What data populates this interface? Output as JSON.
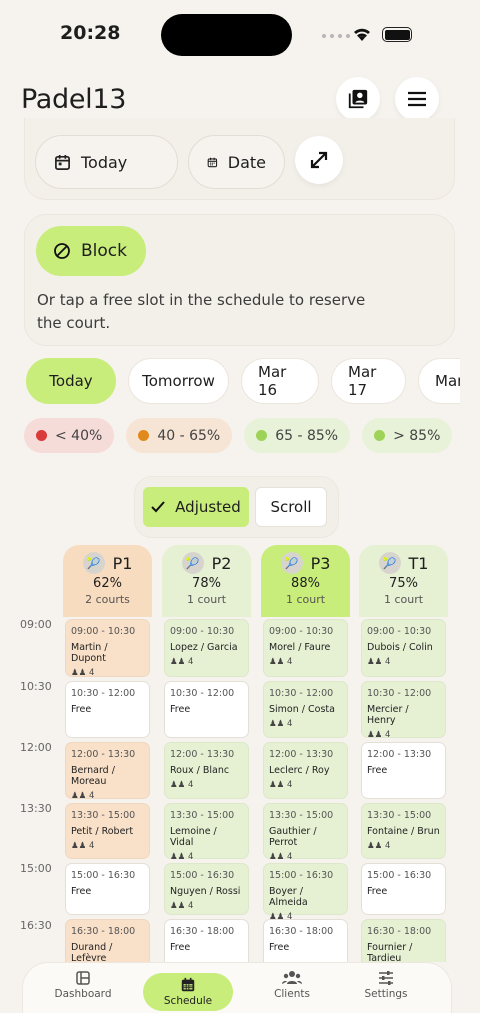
{
  "status": {
    "time": "20:28"
  },
  "header": {
    "title": "Padel13"
  },
  "toolbar": {
    "today_label": "Today",
    "date_label": "Date"
  },
  "block": {
    "label": "Block",
    "hint": "Or tap a free slot in the schedule to reserve the court."
  },
  "date_chips": [
    "Today",
    "Tomorrow",
    "Mar 16",
    "Mar 17",
    "Mar"
  ],
  "legend": [
    {
      "label": "< 40%",
      "dot": "#d93a3a",
      "bg": "#f6dcd9"
    },
    {
      "label": "40 - 65%",
      "dot": "#e08a1e",
      "bg": "#f6e4d4"
    },
    {
      "label": "65 - 85%",
      "dot": "#9ed35a",
      "bg": "#e8f2d8"
    },
    {
      "label": "> 85%",
      "dot": "#9ed35a",
      "bg": "#e8f2d8"
    }
  ],
  "view": {
    "adjusted": "Adjusted",
    "scroll": "Scroll"
  },
  "times": [
    "09:00",
    "10:30",
    "12:00",
    "13:30",
    "15:00",
    "16:30"
  ],
  "courts": [
    {
      "name": "P1",
      "pct": "62%",
      "count": "2 courts",
      "bg": "#f8dcc0",
      "slotbg": "#f9e0c8"
    },
    {
      "name": "P2",
      "pct": "78%",
      "count": "1 court",
      "bg": "#e6f0d3",
      "slotbg": "#e6f1d3"
    },
    {
      "name": "P3",
      "pct": "88%",
      "count": "1 court",
      "bg": "#c8ed7a",
      "slotbg": "#e6f1d3"
    },
    {
      "name": "T1",
      "pct": "75%",
      "count": "1 court",
      "bg": "#e6f0d3",
      "slotbg": "#e6f1d3"
    }
  ],
  "slots": [
    [
      {
        "time": "09:00 - 10:30",
        "name": "Martin / Dupont",
        "players": "4"
      },
      {
        "time": "10:30 - 12:00",
        "name": "Free",
        "players": ""
      },
      {
        "time": "12:00 - 13:30",
        "name": "Bernard / Moreau",
        "players": "4"
      },
      {
        "time": "13:30 - 15:00",
        "name": "Petit / Robert",
        "players": "4"
      },
      {
        "time": "15:00 - 16:30",
        "name": "Free",
        "players": ""
      },
      {
        "time": "16:30 - 18:00",
        "name": "Durand / Lefèvre",
        "players": ""
      }
    ],
    [
      {
        "time": "09:00 - 10:30",
        "name": "Lopez / Garcia",
        "players": "4"
      },
      {
        "time": "10:30 - 12:00",
        "name": "Free",
        "players": ""
      },
      {
        "time": "12:00 - 13:30",
        "name": "Roux / Blanc",
        "players": "4"
      },
      {
        "time": "13:30 - 15:00",
        "name": "Lemoine / Vidal",
        "players": "4"
      },
      {
        "time": "15:00 - 16:30",
        "name": "Nguyen / Rossi",
        "players": "4"
      },
      {
        "time": "16:30 - 18:00",
        "name": "Free",
        "players": ""
      }
    ],
    [
      {
        "time": "09:00 - 10:30",
        "name": "Morel / Faure",
        "players": "4"
      },
      {
        "time": "10:30 - 12:00",
        "name": "Simon / Costa",
        "players": "4"
      },
      {
        "time": "12:00 - 13:30",
        "name": "Leclerc / Roy",
        "players": "4"
      },
      {
        "time": "13:30 - 15:00",
        "name": "Gauthier / Perrot",
        "players": "4"
      },
      {
        "time": "15:00 - 16:30",
        "name": "Boyer / Almeida",
        "players": "4"
      },
      {
        "time": "16:30 - 18:00",
        "name": "Free",
        "players": ""
      }
    ],
    [
      {
        "time": "09:00 - 10:30",
        "name": "Dubois / Colin",
        "players": "4"
      },
      {
        "time": "10:30 - 12:00",
        "name": "Mercier / Henry",
        "players": "4"
      },
      {
        "time": "12:00 - 13:30",
        "name": "Free",
        "players": ""
      },
      {
        "time": "13:30 - 15:00",
        "name": "Fontaine / Brun",
        "players": "4"
      },
      {
        "time": "15:00 - 16:30",
        "name": "Free",
        "players": ""
      },
      {
        "time": "16:30 - 18:00",
        "name": "Fournier / Tardieu",
        "players": ""
      }
    ]
  ],
  "nav": [
    {
      "label": "Dashboard",
      "icon": "dashboard-icon"
    },
    {
      "label": "Schedule",
      "icon": "calendar-icon"
    },
    {
      "label": "Clients",
      "icon": "people-icon"
    },
    {
      "label": "Settings",
      "icon": "sliders-icon"
    }
  ]
}
